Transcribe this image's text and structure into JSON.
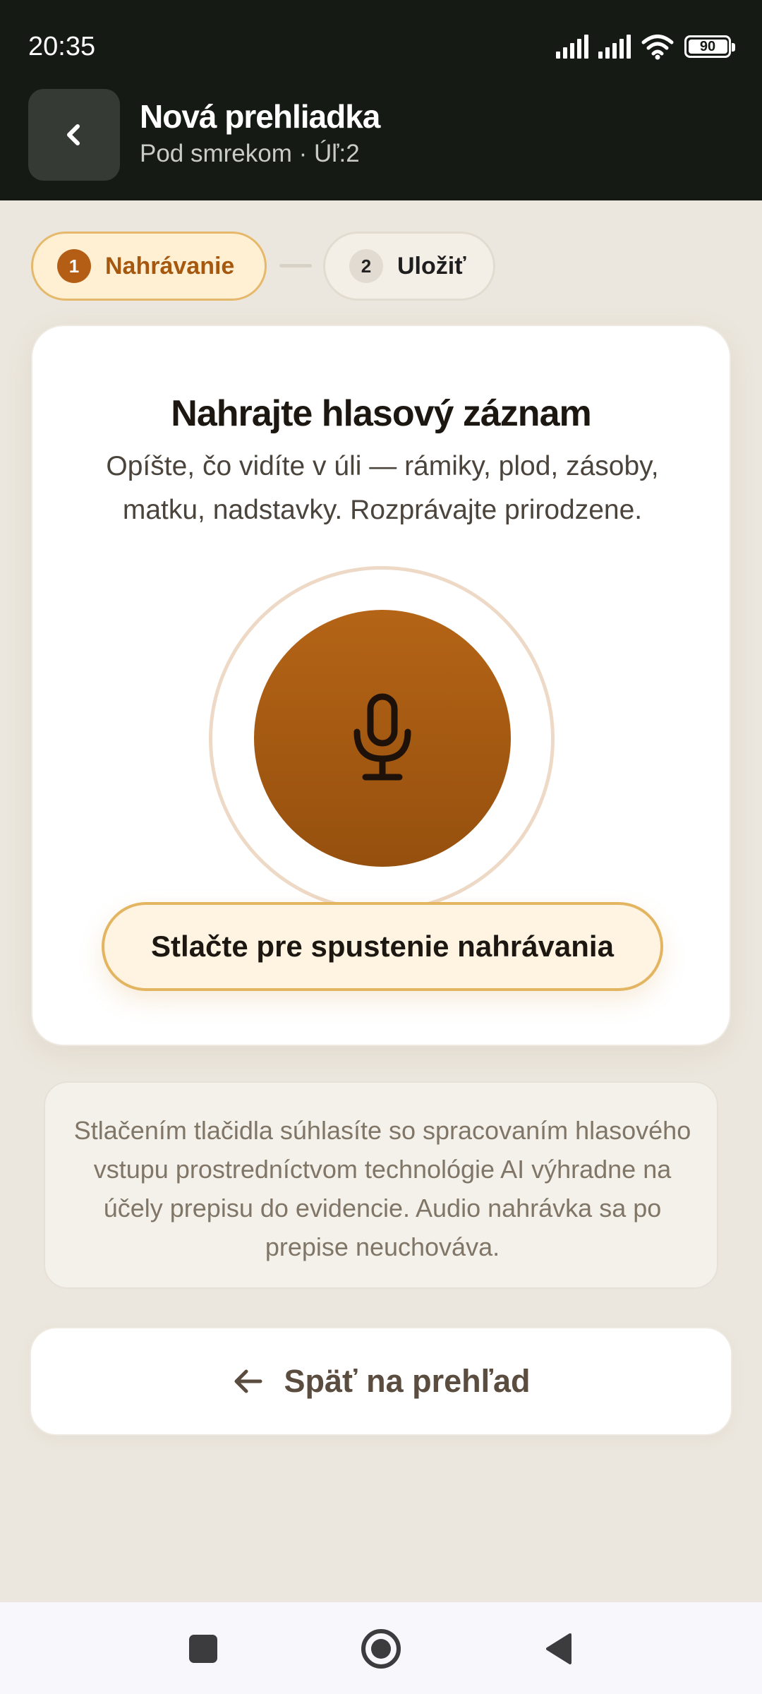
{
  "status_bar": {
    "time": "20:35",
    "battery": "90",
    "icons": [
      "signal-icon",
      "signal-icon",
      "wifi-icon",
      "battery-icon"
    ]
  },
  "header": {
    "back_icon": "chevron-left-icon",
    "title": "Nová prehliadka",
    "subtitle": "Pod smrekom · Úľ:2"
  },
  "stepper": {
    "steps": [
      {
        "number": "1",
        "label": "Nahrávanie",
        "active": true
      },
      {
        "number": "2",
        "label": "Uložiť",
        "active": false
      }
    ]
  },
  "record_card": {
    "title": "Nahrajte hlasový záznam",
    "description": "Opíšte, čo vidíte v úli — rámiky, plod, zásoby, matku, nadstavky. Rozprávajte prirodzene.",
    "mic_icon": "microphone-icon",
    "hint_button": "Stlačte pre spustenie nahrávania",
    "accent_color": "#A85A12"
  },
  "consent_note": {
    "text": "Stlačením tlačidla súhlasíte so spracovaním hlasového vstupu prostredníctvom technológie AI výhradne na účely prepisu do evidencie. Audio nahrávka sa po prepise neuchováva."
  },
  "footer_action": {
    "icon": "arrow-left-icon",
    "label": "Späť na prehľad"
  },
  "nav_bar": {
    "icons": [
      "recents-square-icon",
      "home-circle-icon",
      "back-triangle-icon"
    ]
  }
}
